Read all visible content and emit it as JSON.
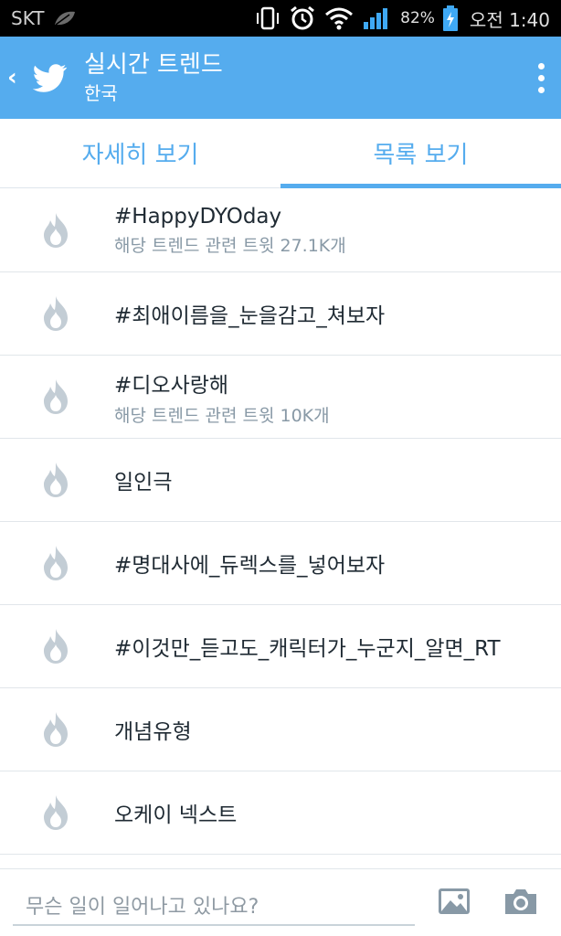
{
  "status_bar": {
    "carrier": "SKT",
    "battery_percent": "82%",
    "time": "오전 1:40"
  },
  "app_bar": {
    "title": "실시간 트렌드",
    "subtitle": "한국"
  },
  "tabs": [
    {
      "label": "자세히 보기",
      "active": false
    },
    {
      "label": "목록 보기",
      "active": true
    }
  ],
  "trends": [
    {
      "name": "#HappyDYOday",
      "detail": "해당 트렌드 관련 트윗 27.1K개"
    },
    {
      "name": "#최애이름을_눈을감고_쳐보자",
      "detail": ""
    },
    {
      "name": "#디오사랑해",
      "detail": "해당 트렌드 관련 트윗 10K개"
    },
    {
      "name": "일인극",
      "detail": ""
    },
    {
      "name": "#명대사에_듀렉스를_넣어보자",
      "detail": ""
    },
    {
      "name": "#이것만_듣고도_캐릭터가_누군지_알면_RT",
      "detail": ""
    },
    {
      "name": "개념유형",
      "detail": ""
    },
    {
      "name": "오케이 넥스트",
      "detail": ""
    }
  ],
  "compose": {
    "placeholder": "무슨 일이 일어나고 있나요?"
  },
  "colors": {
    "accent": "#55acee",
    "highlight": "#a7e0c8",
    "flame": "#c3cdd5"
  }
}
